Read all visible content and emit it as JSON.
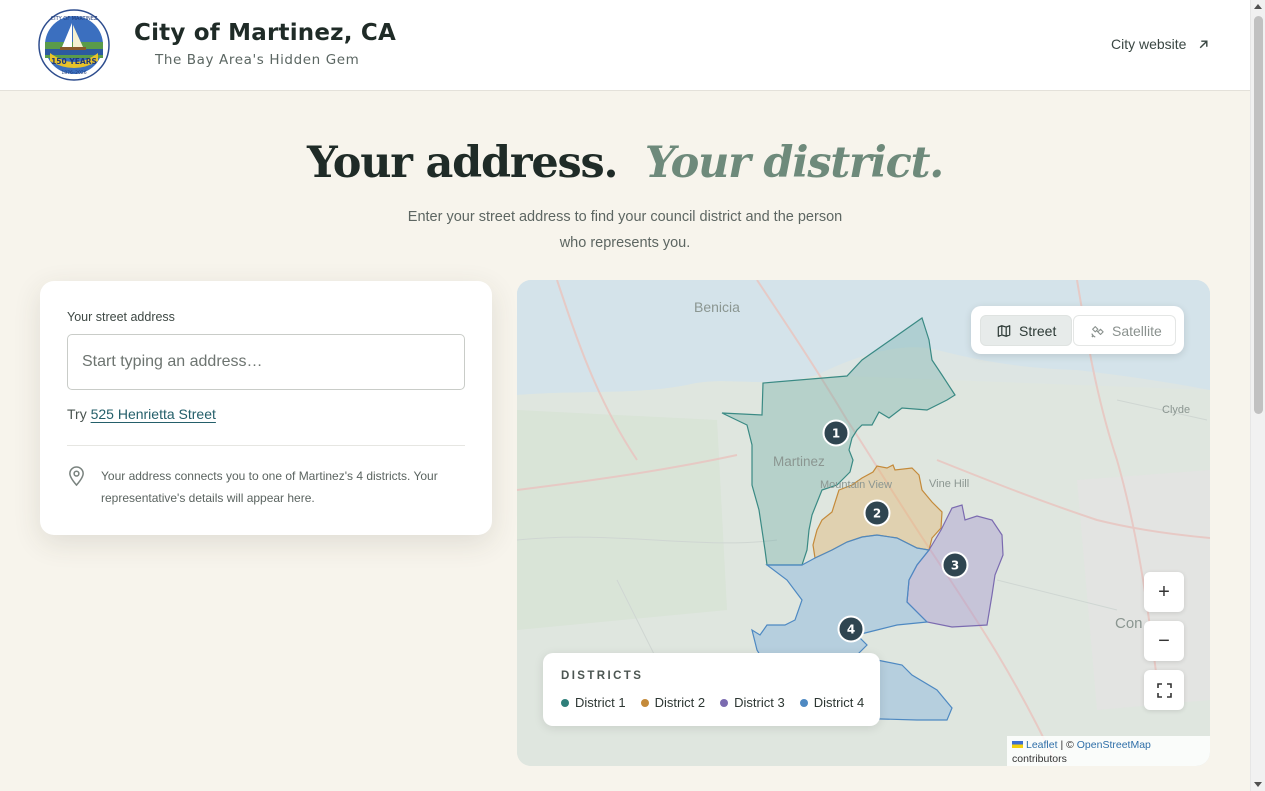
{
  "header": {
    "seal": {
      "top_text": "CITY OF MARTINEZ",
      "years_text": "150 YEARS",
      "dates_text": "1876–2026"
    },
    "title": "City of Martinez, CA",
    "tagline": "The Bay Area's Hidden Gem",
    "city_link": "City website",
    "city_link_icon": "arrow-up-right-icon"
  },
  "hero": {
    "title_plain": "Your address.",
    "title_italic": "Your district.",
    "subtitle": "Enter your street address to find your council district and the person who represents you."
  },
  "search": {
    "label": "Your street address",
    "value": "",
    "placeholder": "Start typing an address…",
    "try_prefix": "Try",
    "try_example": "525 Henrietta Street",
    "info_icon": "map-pin-icon",
    "info_text": "Your address connects you to one of Martinez's 4 districts. Your representative's details will appear here."
  },
  "map": {
    "place_labels": [
      "Benicia",
      "Martinez",
      "Mountain View",
      "Vine Hill",
      "Clyde",
      "Con"
    ],
    "layer_toggle": {
      "street": {
        "label": "Street",
        "icon": "map-icon",
        "selected": true
      },
      "satellite": {
        "label": "Satellite",
        "icon": "satellite-icon",
        "selected": false
      }
    },
    "zoom_in": "+",
    "zoom_out": "−",
    "fullscreen_icon": "fullscreen-icon",
    "markers": [
      "1",
      "2",
      "3",
      "4"
    ],
    "legend": {
      "title": "DISTRICTS",
      "items": [
        {
          "label": "District 1",
          "color": "#2f7f7a"
        },
        {
          "label": "District 2",
          "color": "#c48a3a"
        },
        {
          "label": "District 3",
          "color": "#7b6bb0"
        },
        {
          "label": "District 4",
          "color": "#4e89c2"
        }
      ]
    },
    "attribution": {
      "leaflet": "Leaflet",
      "separator": "| ©",
      "osm": "OpenStreetMap",
      "suffix": "contributors"
    }
  },
  "colors": {
    "page_bg": "#f7f4ec",
    "title_dark": "#1f2b27",
    "title_accent": "#6e8a7b",
    "link": "#245f6a",
    "marker": "#2f4550"
  }
}
